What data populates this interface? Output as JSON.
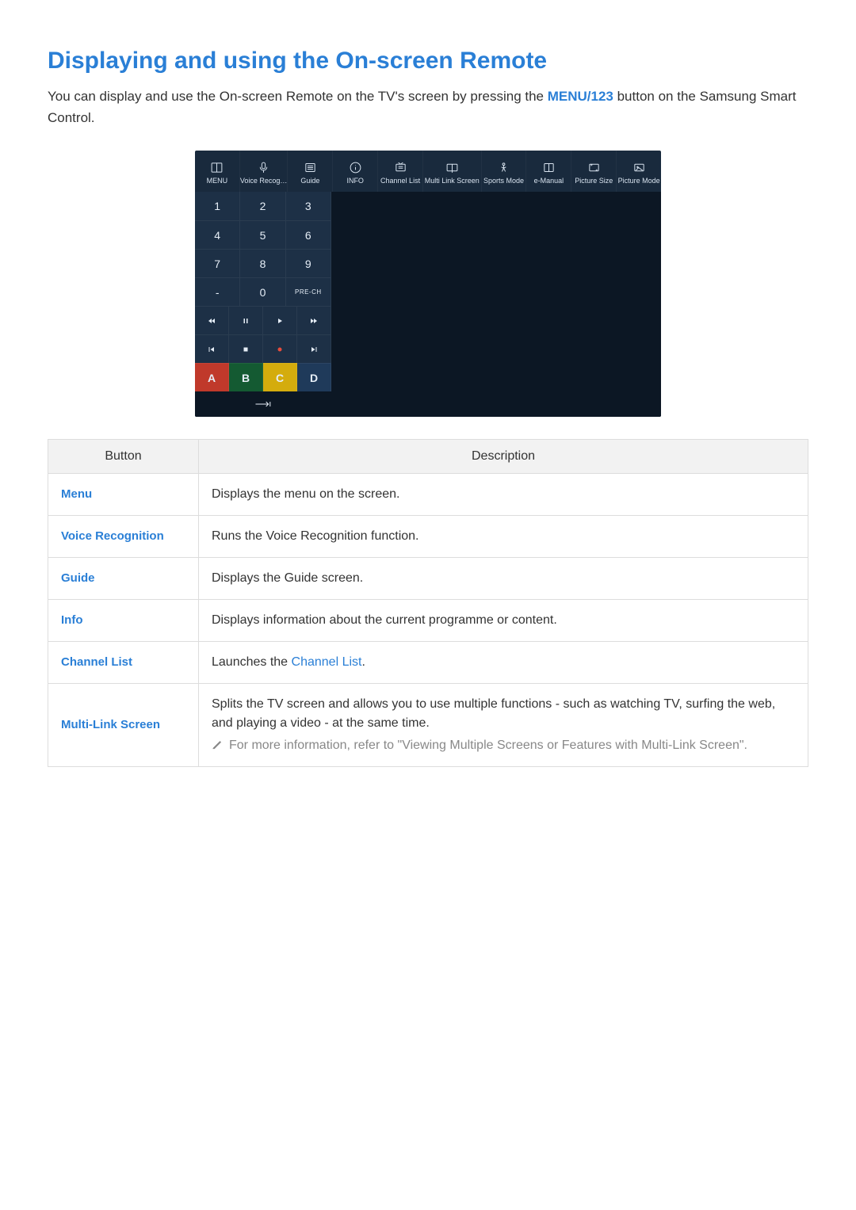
{
  "title": "Displaying and using the On-screen Remote",
  "intro_before": "You can display and use the On-screen Remote on the TV's screen by pressing the ",
  "intro_kw": "MENU/123",
  "intro_after": " button on the Samsung Smart Control.",
  "topbar": [
    {
      "label": "MENU"
    },
    {
      "label": "Voice Recog…"
    },
    {
      "label": "Guide"
    },
    {
      "label": "INFO"
    },
    {
      "label": "Channel List"
    },
    {
      "label": "Multi Link Screen"
    },
    {
      "label": "Sports Mode"
    },
    {
      "label": "e-Manual"
    },
    {
      "label": "Picture Size"
    },
    {
      "label": "Picture Mode"
    }
  ],
  "keypad": {
    "r1": [
      "1",
      "2",
      "3"
    ],
    "r2": [
      "4",
      "5",
      "6"
    ],
    "r3": [
      "7",
      "8",
      "9"
    ],
    "r4_dash": "-",
    "r4_zero": "0",
    "r4_prech": "PRE-CH",
    "colors": {
      "a": "A",
      "b": "B",
      "c": "C",
      "d": "D"
    }
  },
  "table": {
    "head_button": "Button",
    "head_desc": "Description",
    "rows": [
      {
        "name": "Menu",
        "desc": "Displays the menu on the screen."
      },
      {
        "name": "Voice Recognition",
        "desc": "Runs the Voice Recognition function."
      },
      {
        "name": "Guide",
        "desc": "Displays the Guide screen."
      },
      {
        "name": "Info",
        "desc": "Displays information about the current programme or content."
      }
    ],
    "channel_row": {
      "name": "Channel List",
      "desc_before": "Launches the ",
      "desc_link": "Channel List",
      "desc_after": "."
    },
    "mls_row": {
      "name": "Multi-Link Screen",
      "desc_main": "Splits the TV screen and allows you to use multiple functions - such as watching TV, surfing the web, and playing a video - at the same time.",
      "desc_note": "For more information, refer to \"Viewing Multiple Screens or Features with Multi-Link Screen\"."
    }
  }
}
